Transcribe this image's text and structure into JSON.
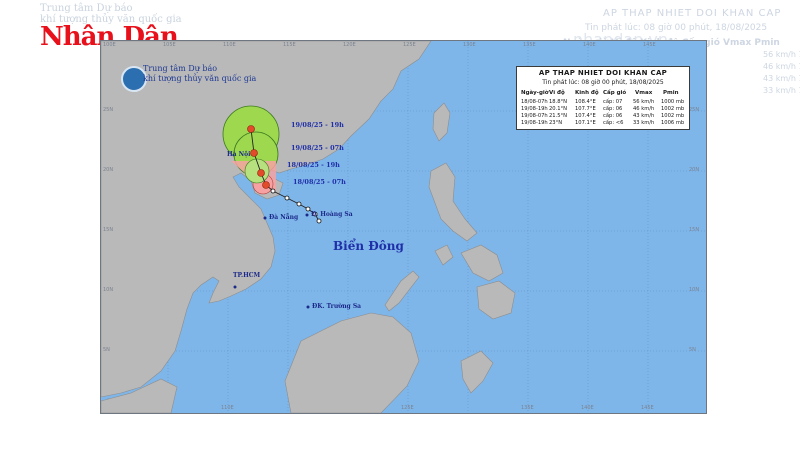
{
  "branding": {
    "logo_text": "Nhân Dân",
    "faded_caption_1": "Trung tâm Dự báo",
    "faded_caption_2": "khí tượng thủy văn quốc gia"
  },
  "agency": {
    "line1": "Trung tâm Dự báo",
    "line2": "khí tượng thủy văn quốc gia"
  },
  "legend": {
    "title": "AP THAP NHIET DOI KHAN CAP",
    "subtitle": "Tin phát lúc: 08 giờ 00 phút, 18/08/2025",
    "headers": [
      "Ngày-giờ",
      "Vĩ độ",
      "Kinh độ",
      "Cấp gió",
      "Vmax",
      "Pmin"
    ],
    "rows": [
      [
        "18/08-07h",
        "18.8°N",
        "108.4°E",
        "cấp: 07",
        "56 km/h",
        "1000 mb"
      ],
      [
        "19/08-19h",
        "20.1°N",
        "107.7°E",
        "cấp: 06",
        "46 km/h",
        "1002 mb"
      ],
      [
        "19/08-07h",
        "21.5°N",
        "107.4°E",
        "cấp: 06",
        "43 km/h",
        "1002 mb"
      ],
      [
        "19/08-19h",
        "23°N",
        "107.1°E",
        "cấp: <6",
        "33 km/h",
        "1006 mb"
      ]
    ]
  },
  "faded_table": {
    "title": "AP THAP NHIET DOI KHAN CAP",
    "subtitle": "Tin phát lúc: 08 giờ 00 phút, 18/08/2025",
    "header": "Ngày-giờ Vĩ độ  Kinh độ Cấp gió Vmax   Pmin",
    "rows": [
      "56 km/h 1000 mb",
      "46 km/h 1002 mb",
      "43 km/h 1002 mb",
      "33 km/h 1006 mb"
    ],
    "watermark": "nhandan.vn"
  },
  "track_labels": [
    "19/08/25 - 19h",
    "19/08/25 - 07h",
    "18/08/25 - 19h",
    "18/08/25 - 07h"
  ],
  "places": {
    "hanoi": "Hà Nội",
    "danang": "Đà Nẵng",
    "hoangsa": "Đ. Hoàng Sa",
    "hcm": "TP.HCM",
    "truongsa": "ĐK. Trường Sa",
    "sea": "Biển Đông"
  },
  "lon_ticks": [
    "100E",
    "105E",
    "110E",
    "115E",
    "120E",
    "125E",
    "130E",
    "135E",
    "140E",
    "145E"
  ],
  "lat_ticks": [
    "25N",
    "20N",
    "15N",
    "10N",
    "5N"
  ],
  "colors": {
    "sea": "#7fb6ea",
    "land": "#b9b9b9",
    "cone_outer": "#9ed84f",
    "cone_inner": "#f6a2a2",
    "track": "#222222",
    "logo_red": "#e8101b"
  }
}
